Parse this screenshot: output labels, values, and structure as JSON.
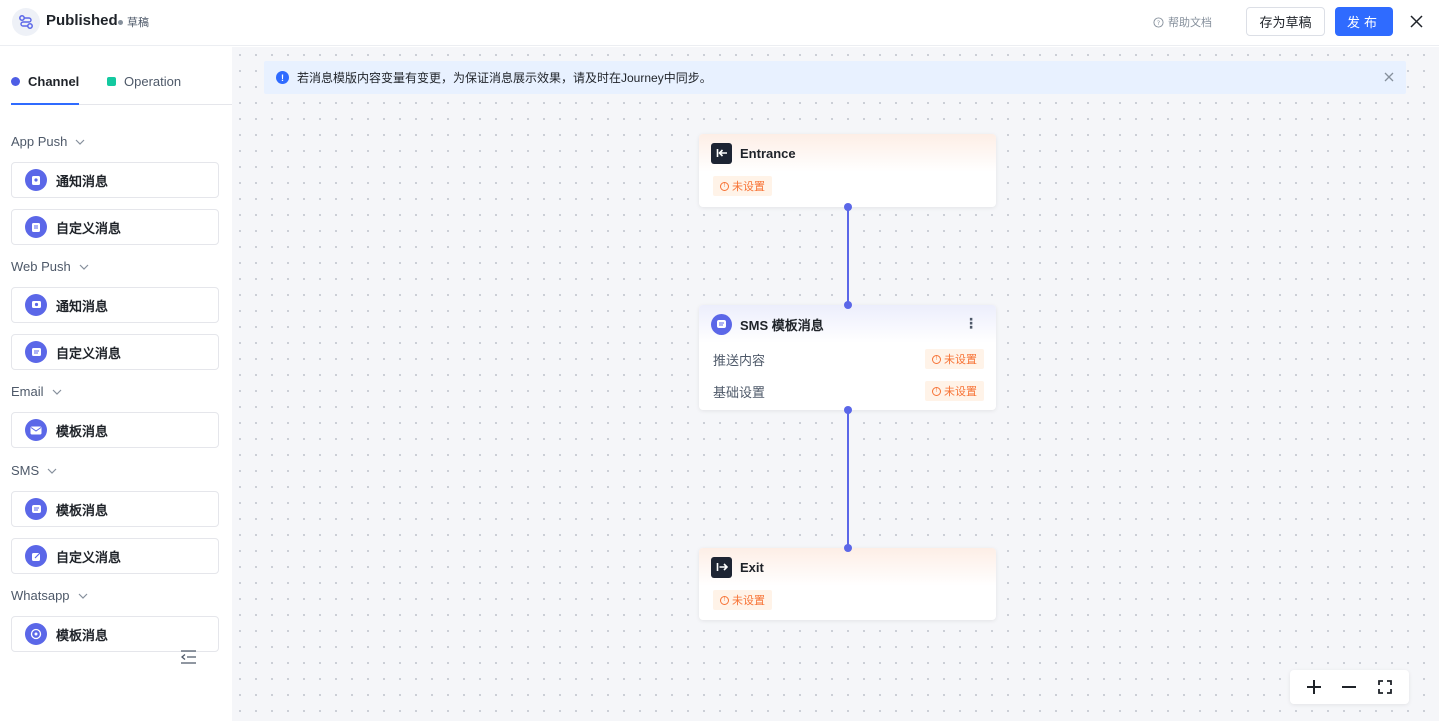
{
  "header": {
    "title": "Published",
    "status": "草稿",
    "help_label": "帮助文档",
    "save_draft_label": "存为草稿",
    "publish_label": "发布"
  },
  "sidebar": {
    "tabs": [
      {
        "label": "Channel",
        "active": true,
        "color": "#4e5ee5"
      },
      {
        "label": "Operation",
        "active": false,
        "color": "#14c9a0"
      }
    ],
    "groups": [
      {
        "label": "App Push",
        "items": [
          {
            "label": "通知消息",
            "icon": "bell-icon"
          },
          {
            "label": "自定义消息",
            "icon": "document-icon"
          }
        ]
      },
      {
        "label": "Web Push",
        "items": [
          {
            "label": "通知消息",
            "icon": "bell-icon"
          },
          {
            "label": "自定义消息",
            "icon": "message-icon"
          }
        ]
      },
      {
        "label": "Email",
        "items": [
          {
            "label": "模板消息",
            "icon": "mail-icon"
          }
        ]
      },
      {
        "label": "SMS",
        "items": [
          {
            "label": "模板消息",
            "icon": "sms-icon"
          },
          {
            "label": "自定义消息",
            "icon": "edit-icon"
          }
        ]
      },
      {
        "label": "Whatsapp",
        "items": [
          {
            "label": "模板消息",
            "icon": "whatsapp-icon"
          }
        ]
      }
    ]
  },
  "canvas": {
    "banner_text": "若消息模版内容变量有变更，为保证消息展示效果，请及时在Journey中同步。",
    "nodes": {
      "entrance": {
        "title": "Entrance",
        "status": "未设置"
      },
      "sms": {
        "title": "SMS 模板消息",
        "rows": [
          {
            "label": "推送内容",
            "status": "未设置"
          },
          {
            "label": "基础设置",
            "status": "未设置"
          }
        ]
      },
      "exit": {
        "title": "Exit",
        "status": "未设置"
      }
    }
  },
  "colors": {
    "accent": "#2f6bff",
    "node_icon": "#5b67e8",
    "warning": "#f77234"
  }
}
